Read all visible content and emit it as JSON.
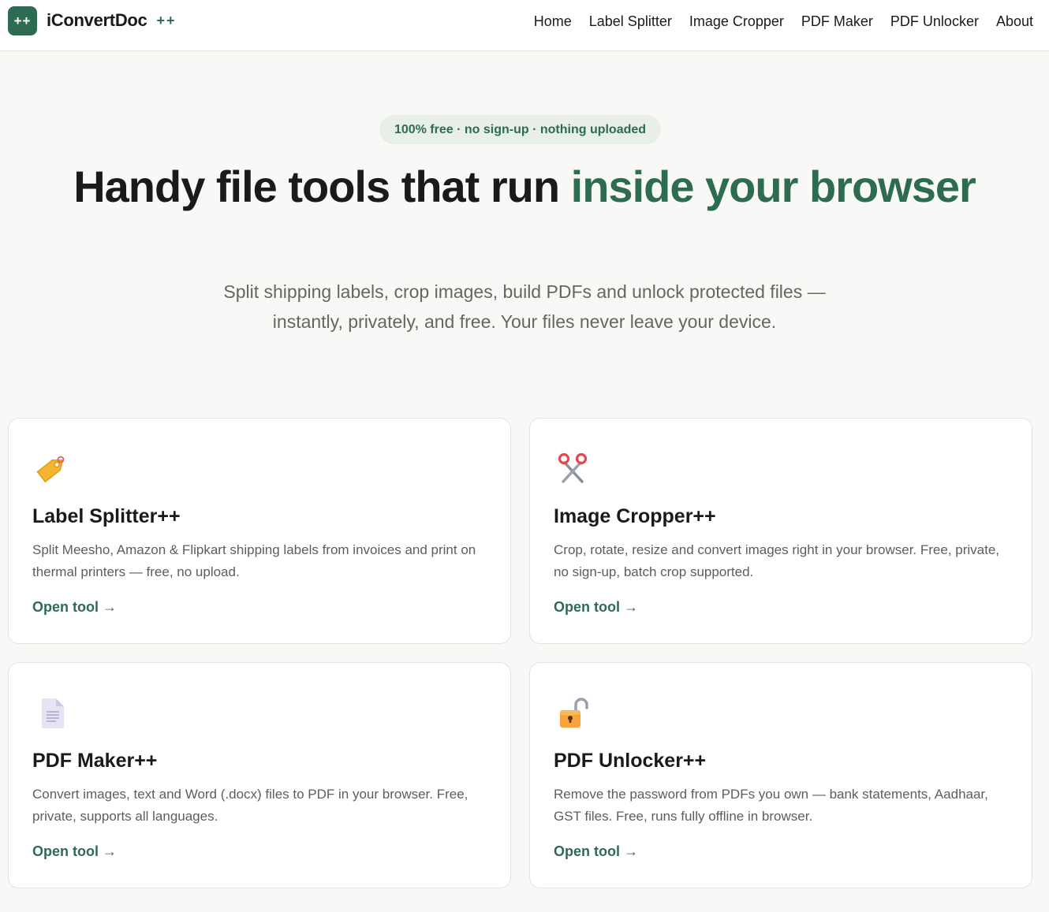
{
  "header": {
    "logo_text": "++",
    "brand_name": "iConvertDoc",
    "brand_suffix": "++",
    "nav": [
      {
        "label": "Home"
      },
      {
        "label": "Label Splitter"
      },
      {
        "label": "Image Cropper"
      },
      {
        "label": "PDF Maker"
      },
      {
        "label": "PDF Unlocker"
      },
      {
        "label": "About"
      }
    ]
  },
  "hero": {
    "badge": "100% free · no sign-up · nothing uploaded",
    "title_plain": "Handy file tools that run ",
    "title_highlight": "inside your browser",
    "subtitle": "Split shipping labels, crop images, build PDFs and unlock protected files — instantly, privately, and free. Your files never leave your device."
  },
  "accent_color": "#2e6b53",
  "tools": [
    {
      "icon": "tag-icon",
      "title": "Label Splitter++",
      "description": "Split Meesho, Amazon & Flipkart shipping labels from invoices and print on thermal printers — free, no upload.",
      "link": "Open tool →"
    },
    {
      "icon": "scissors-icon",
      "title": "Image Cropper++",
      "description": "Crop, rotate, resize and convert images right in your browser. Free, private, no sign-up, batch crop supported.",
      "link": "Open tool →"
    },
    {
      "icon": "document-icon",
      "title": "PDF Maker++",
      "description": "Convert images, text and Word (.docx) files to PDF in your browser. Free, private, supports all languages.",
      "link": "Open tool →"
    },
    {
      "icon": "unlock-icon",
      "title": "PDF Unlocker++",
      "description": "Remove the password from PDFs you own — bank statements, Aadhaar, GST files. Free, runs fully offline in browser.",
      "link": "Open tool →"
    }
  ]
}
